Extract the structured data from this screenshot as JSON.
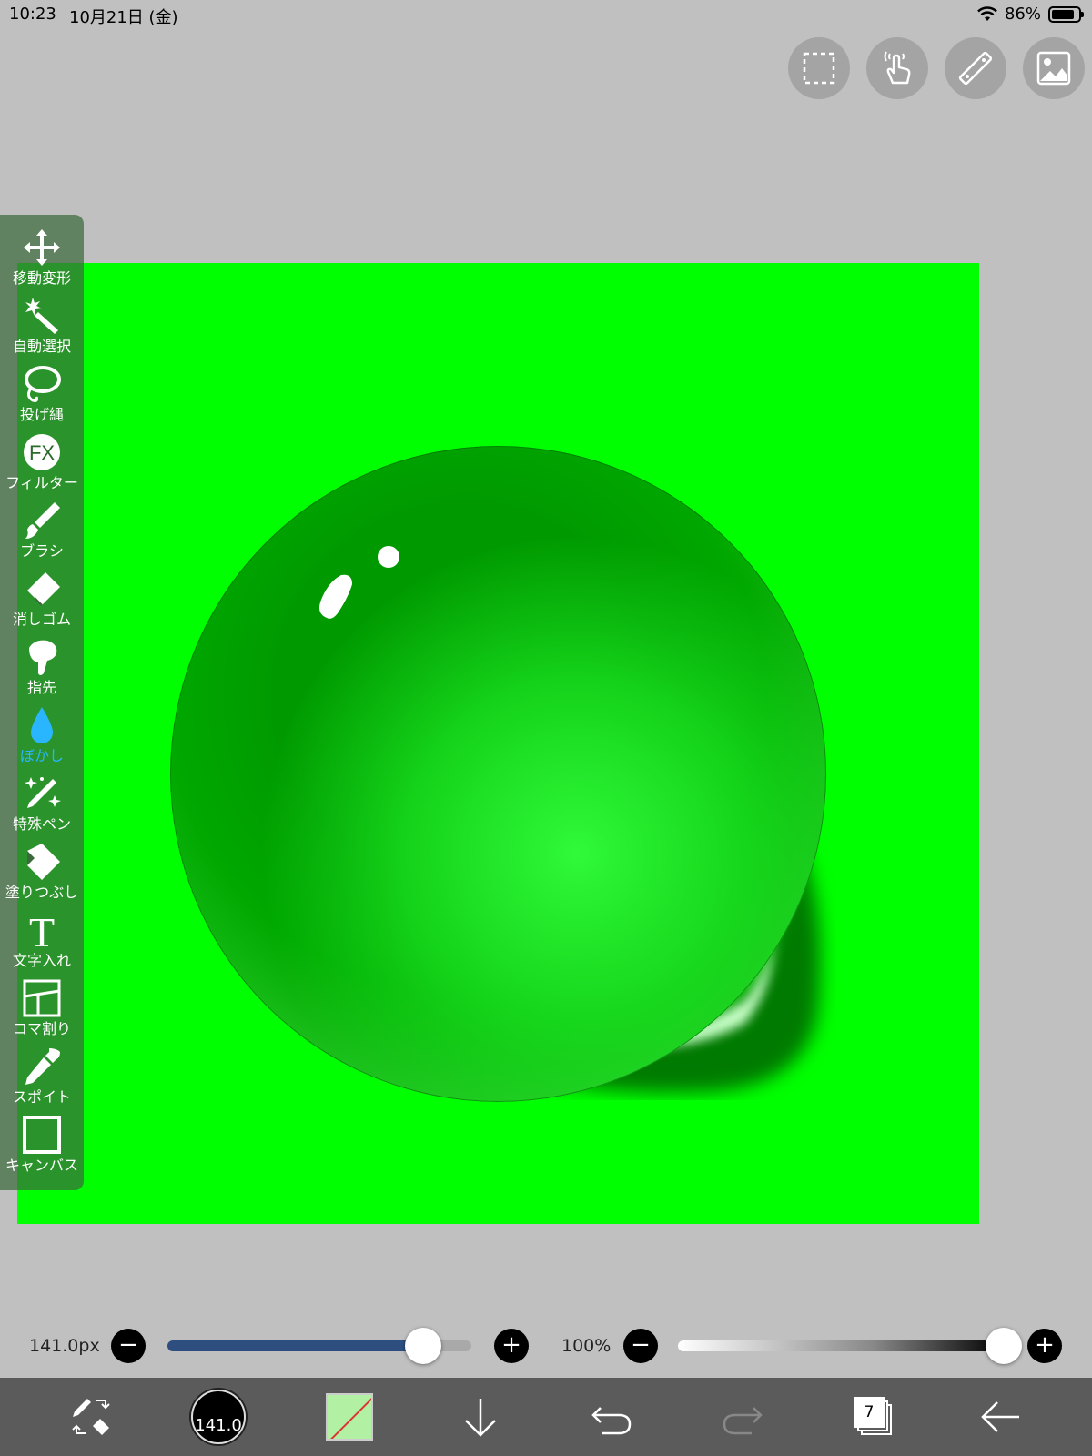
{
  "status_bar": {
    "time": "10:23",
    "date": "10月21日 (金)",
    "battery": "86%",
    "battery_level": 0.86
  },
  "top_tools": [
    {
      "name": "selection-icon"
    },
    {
      "name": "touch-gesture-icon"
    },
    {
      "name": "ruler-icon"
    },
    {
      "name": "material-image-icon"
    }
  ],
  "toolbar": {
    "tools": [
      {
        "label": "移動変形",
        "icon": "move-transform-icon"
      },
      {
        "label": "自動選択",
        "icon": "magic-wand-icon"
      },
      {
        "label": "投げ縄",
        "icon": "lasso-icon"
      },
      {
        "label": "フィルター",
        "icon": "filter-fx-icon",
        "icon_text": "FX"
      },
      {
        "label": "ブラシ",
        "icon": "brush-icon"
      },
      {
        "label": "消しゴム",
        "icon": "eraser-icon"
      },
      {
        "label": "指先",
        "icon": "finger-smudge-icon"
      },
      {
        "label": "ぼかし",
        "icon": "blur-drop-icon",
        "active": true
      },
      {
        "label": "特殊ペン",
        "icon": "special-pen-icon"
      },
      {
        "label": "塗りつぶし",
        "icon": "fill-bucket-icon"
      },
      {
        "label": "文字入れ",
        "icon": "text-icon",
        "icon_text": "T"
      },
      {
        "label": "コマ割り",
        "icon": "frame-divider-icon"
      },
      {
        "label": "スポイト",
        "icon": "eyedropper-icon"
      },
      {
        "label": "キャンバス",
        "icon": "canvas-icon"
      }
    ]
  },
  "canvas": {
    "background_color": "#00ff00",
    "drop_color": "#00a000"
  },
  "brush_size_slider": {
    "value_label": "141.0px",
    "minus": "−",
    "plus": "+",
    "level": 0.84,
    "track_color": "#2d4e7e"
  },
  "opacity_slider": {
    "value_label": "100%",
    "minus": "−",
    "plus": "+",
    "level": 1.0
  },
  "bottom_bar": {
    "brush_size_label": "141.0",
    "layer_count": "7",
    "primary_color": "#b2f0a4"
  }
}
